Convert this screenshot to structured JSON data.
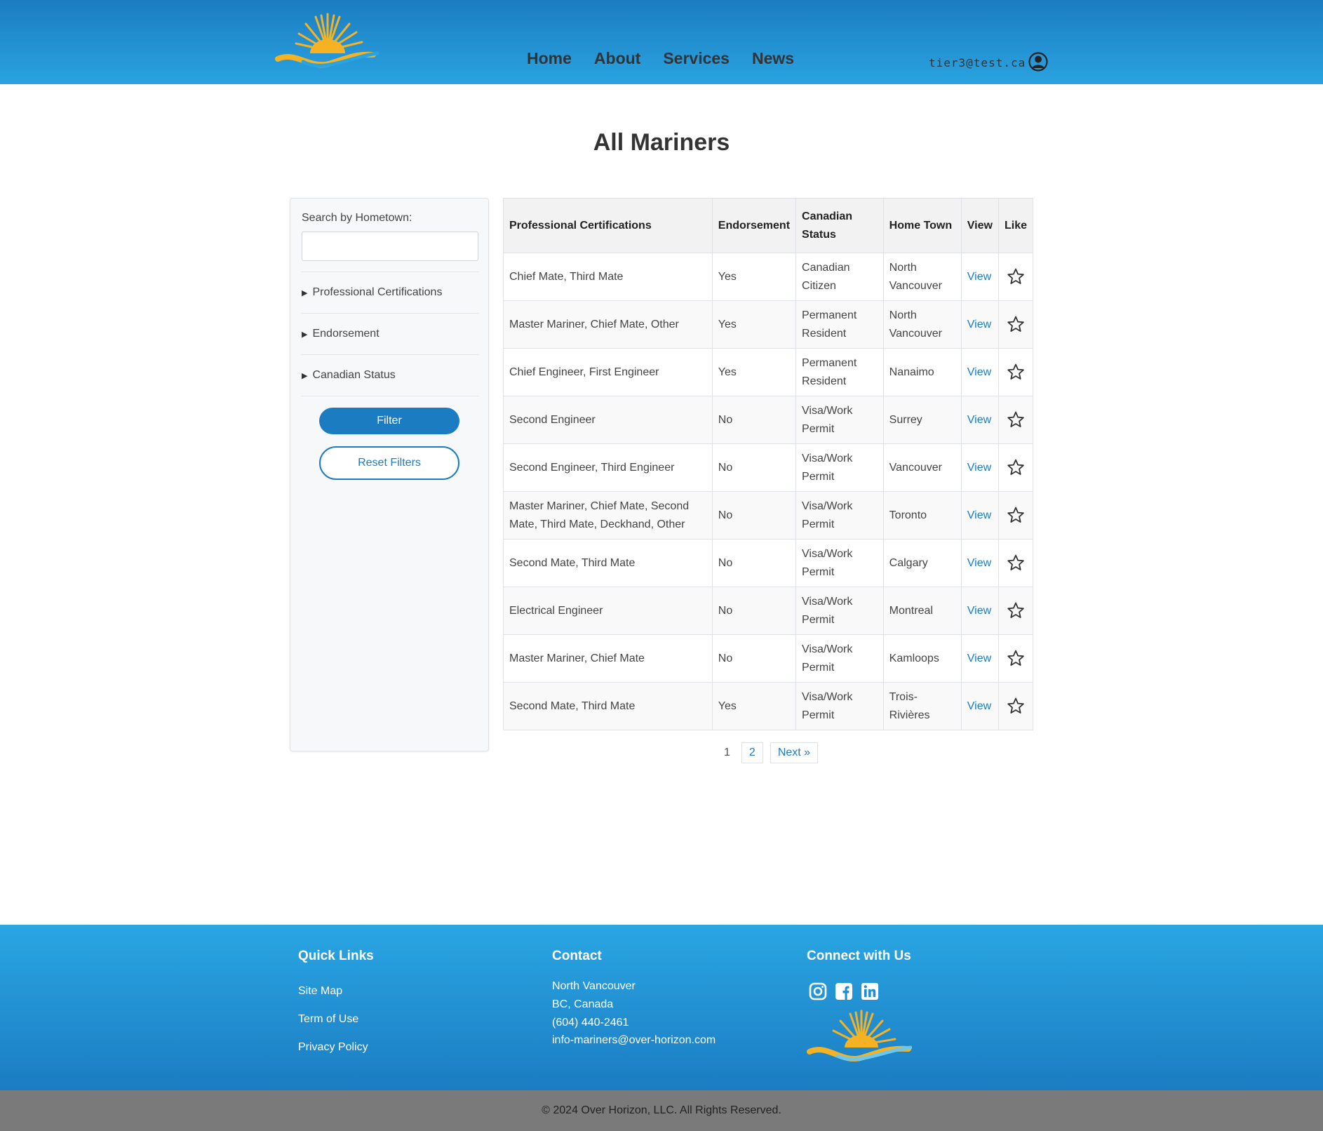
{
  "header": {
    "nav": [
      "Home",
      "About",
      "Services",
      "News"
    ],
    "user_email": "tier3@test.ca"
  },
  "page_title": "All Mariners",
  "sidebar": {
    "search_label": "Search by Hometown:",
    "search_value": "",
    "sections": [
      "Professional Certifications",
      "Endorsement",
      "Canadian Status"
    ],
    "filter_label": "Filter",
    "reset_label": "Reset Filters"
  },
  "table": {
    "headers": {
      "certs": "Professional Certifications",
      "endorsement": "Endorsement",
      "status": "Canadian Status",
      "hometown": "Home Town",
      "view": "View",
      "like": "Like"
    },
    "rows": [
      {
        "certs": "Chief Mate, Third Mate",
        "endorsement": "Yes",
        "status": "Canadian Citizen",
        "hometown": "North Vancouver",
        "view": "View"
      },
      {
        "certs": "Master Mariner, Chief Mate, Other",
        "endorsement": "Yes",
        "status": "Permanent Resident",
        "hometown": "North Vancouver",
        "view": "View"
      },
      {
        "certs": "Chief Engineer, First Engineer",
        "endorsement": "Yes",
        "status": "Permanent Resident",
        "hometown": "Nanaimo",
        "view": "View"
      },
      {
        "certs": "Second Engineer",
        "endorsement": "No",
        "status": "Visa/Work Permit",
        "hometown": "Surrey",
        "view": "View"
      },
      {
        "certs": "Second Engineer, Third Engineer",
        "endorsement": "No",
        "status": "Visa/Work Permit",
        "hometown": "Vancouver",
        "view": "View"
      },
      {
        "certs": "Master Mariner, Chief Mate, Second Mate, Third Mate, Deckhand, Other",
        "endorsement": "No",
        "status": "Visa/Work Permit",
        "hometown": "Toronto",
        "view": "View"
      },
      {
        "certs": "Second Mate, Third Mate",
        "endorsement": "No",
        "status": "Visa/Work Permit",
        "hometown": "Calgary",
        "view": "View"
      },
      {
        "certs": "Electrical Engineer",
        "endorsement": "No",
        "status": "Visa/Work Permit",
        "hometown": "Montreal",
        "view": "View"
      },
      {
        "certs": "Master Mariner, Chief Mate",
        "endorsement": "No",
        "status": "Visa/Work Permit",
        "hometown": "Kamloops",
        "view": "View"
      },
      {
        "certs": "Second Mate, Third Mate",
        "endorsement": "Yes",
        "status": "Visa/Work Permit",
        "hometown": "Trois-Rivières",
        "view": "View"
      }
    ]
  },
  "pagination": {
    "current": "1",
    "page2": "2",
    "next": "Next »"
  },
  "footer": {
    "quick_links_title": "Quick Links",
    "quick_links": [
      "Site Map",
      "Term of Use",
      "Privacy Policy"
    ],
    "contact_title": "Contact",
    "contact_lines": [
      "North Vancouver",
      "BC, Canada",
      "(604) 440-2461",
      "info-mariners@over-horizon.com"
    ],
    "connect_title": "Connect with Us",
    "social_icons": [
      "instagram-icon",
      "facebook-icon",
      "linkedin-icon"
    ],
    "copyright": "© 2024 Over Horizon, LLC. All Rights Reserved."
  },
  "colors": {
    "brand_blue": "#1b7cc2",
    "header_light": "#2aa3e0",
    "sun_yellow": "#f5b324",
    "copyright_bg": "#7a7a7a"
  }
}
